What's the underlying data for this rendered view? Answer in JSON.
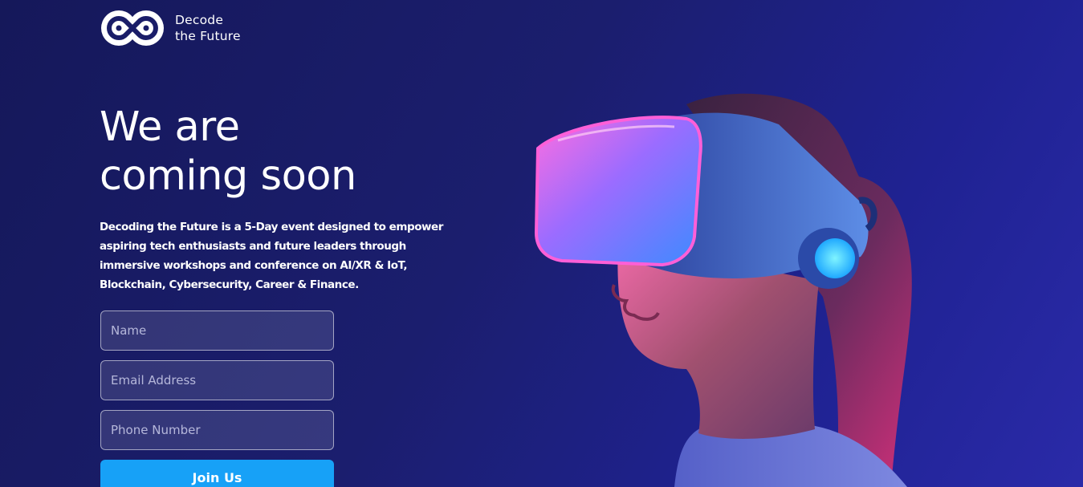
{
  "brand": {
    "line1": "Decode",
    "line2": "the Future",
    "icon": "infinity-logo-icon"
  },
  "hero": {
    "headline_line1": "We are",
    "headline_line2": "coming soon",
    "description": "Decoding the Future is a 5-Day event designed to empower aspiring tech enthusiasts and future leaders through immersive workshops and conference on AI/XR & IoT, Blockchain, Cybersecurity, Career & Finance.",
    "image": "woman-wearing-vr-headset"
  },
  "form": {
    "name_placeholder": "Name",
    "email_placeholder": "Email Address",
    "phone_placeholder": "Phone Number",
    "submit_label": "Join Us"
  },
  "colors": {
    "background": "#1b1e6e",
    "button": "#17a1f7",
    "headset_pink": "#ff4fd8",
    "headset_blue": "#3f8cff"
  }
}
